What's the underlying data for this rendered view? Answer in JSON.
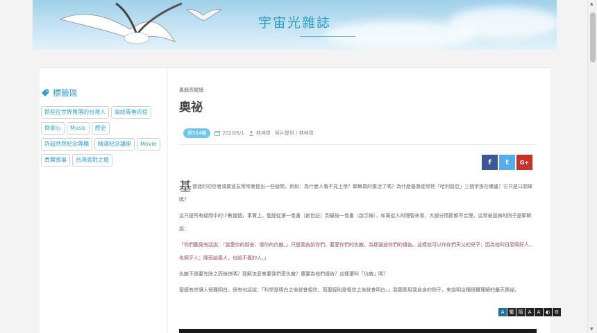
{
  "header": {
    "site_title": "宇宙光雜誌"
  },
  "sidebar": {
    "heading": "標籤區",
    "tags": [
      "那些在世界角落的台灣人",
      "寫給青春的信",
      "齊家心",
      "Music",
      "歷史",
      "許超然然紀念專欄",
      "精選紀念講座",
      "Movie",
      "真實故事",
      "台灣面對之旅"
    ]
  },
  "article": {
    "category": "專題長閱讀",
    "title": "奧祕",
    "issue": "第554期",
    "date": "2020/6/1",
    "author": "林坤瑋",
    "photo_credit": "照片提供 / 林坤瑋",
    "dropcap": "基",
    "paragraphs": [
      {
        "text": "督徒的初信者或慕道友常常會提出一些疑問，例如：為什麼人看不見上帝？耶穌真的復活了嗎？為什麼基督徒常把「哈利路亞」三個字掛在嘴邊？它只是口頭禪嗎？",
        "quote": false
      },
      {
        "text": "這只是所有疑問中的少數幾個，事實上，聖經從第一卷書（創世記）到最後一卷書（啟示錄），如果從人的理智來看，大部分情節都不合理，這常被詬病的例子是耶穌說：",
        "quote": false
      },
      {
        "text": "「你們聽見有話說：『當愛你的鄰舍，恨你的仇敵。』只是我告訴你們，要愛你們的仇敵，為那逼迫你們的禱告。這樣就可以作你們天父的兒子；因為他叫日頭照好人，也照歹人；降雨給義人，也給不義的人。」",
        "quote": true
      },
      {
        "text": "仇敵不是要先除之而後快嗎？耶穌怎麼會要我們愛仇敵？還要為他們禱告？這樣還叫「仇敵」嗎？",
        "quote": false
      },
      {
        "text": "聖經有許讓人很難明白，很有句話說：「科學是明白之後就會相信，而聖經則是相信之後就會明白。」我願意用我自身的例子，來說明這種很難理解的屬天奧祕。",
        "quote": false
      }
    ]
  },
  "share": {
    "facebook": "f",
    "twitter": "t",
    "google_plus": "G+"
  },
  "accessibility": {
    "buttons": [
      "A",
      "繁",
      "简",
      "A",
      "A",
      "◐",
      "⚙"
    ]
  },
  "colors": {
    "accent": "#2a9fd0",
    "badge": "#6ec7ea",
    "facebook": "#3a5898",
    "twitter": "#55acee",
    "google_plus": "#c8322a"
  }
}
